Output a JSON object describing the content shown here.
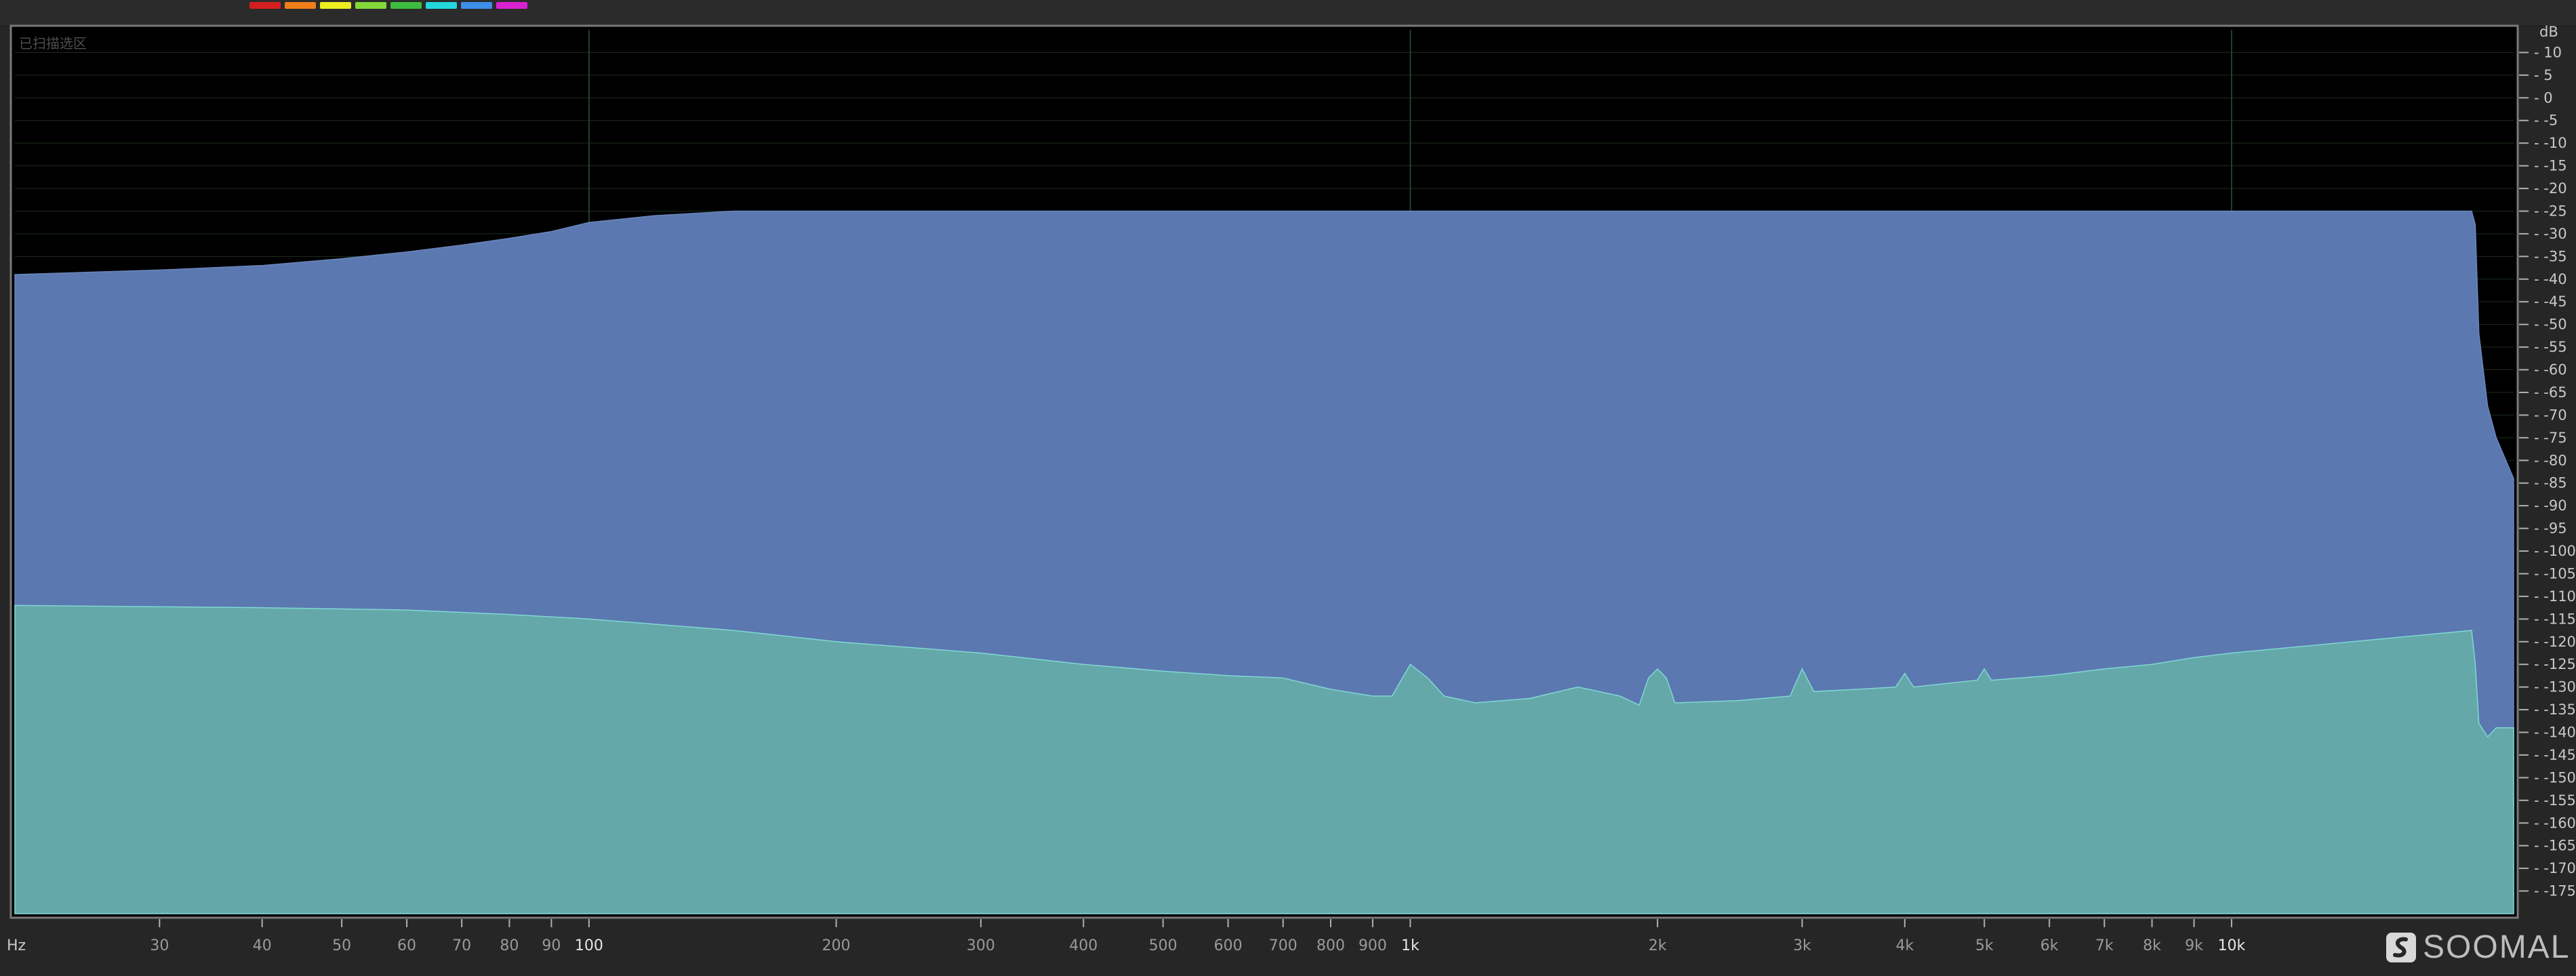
{
  "toolbar": {
    "color_swatches": [
      "#d41f1f",
      "#f07f1a",
      "#eded21",
      "#82d838",
      "#3dbc3d",
      "#24d6dc",
      "#3d8fe8",
      "#d821d0"
    ]
  },
  "overlay_label": "已扫描选区",
  "brand": {
    "name": "SOOMAL"
  },
  "chart_data": {
    "type": "area",
    "x_scale": "log",
    "xlim": [
      20,
      22050
    ],
    "ylim": [
      -180,
      15
    ],
    "xlabel": "Hz",
    "ylabel": "dB",
    "x_ticks": [
      {
        "v": 30,
        "label": "30"
      },
      {
        "v": 40,
        "label": "40"
      },
      {
        "v": 50,
        "label": "50"
      },
      {
        "v": 60,
        "label": "60"
      },
      {
        "v": 70,
        "label": "70"
      },
      {
        "v": 80,
        "label": "80"
      },
      {
        "v": 90,
        "label": "90"
      },
      {
        "v": 100,
        "label": "100"
      },
      {
        "v": 200,
        "label": "200"
      },
      {
        "v": 300,
        "label": "300"
      },
      {
        "v": 400,
        "label": "400"
      },
      {
        "v": 500,
        "label": "500"
      },
      {
        "v": 600,
        "label": "600"
      },
      {
        "v": 700,
        "label": "700"
      },
      {
        "v": 800,
        "label": "800"
      },
      {
        "v": 900,
        "label": "900"
      },
      {
        "v": 1000,
        "label": "1k"
      },
      {
        "v": 2000,
        "label": "2k"
      },
      {
        "v": 3000,
        "label": "3k"
      },
      {
        "v": 4000,
        "label": "4k"
      },
      {
        "v": 5000,
        "label": "5k"
      },
      {
        "v": 6000,
        "label": "6k"
      },
      {
        "v": 7000,
        "label": "7k"
      },
      {
        "v": 8000,
        "label": "8k"
      },
      {
        "v": 9000,
        "label": "9k"
      },
      {
        "v": 10000,
        "label": "10k"
      }
    ],
    "y_ticks": [
      10,
      5,
      0,
      -5,
      -10,
      -15,
      -20,
      -25,
      -30,
      -35,
      -40,
      -45,
      -50,
      -55,
      -60,
      -65,
      -70,
      -75,
      -80,
      -85,
      -90,
      -95,
      -100,
      -105,
      -110,
      -115,
      -120,
      -125,
      -130,
      -135,
      -140,
      -145,
      -150,
      -155,
      -160,
      -165,
      -170,
      -175
    ],
    "major_gridlines_x": [
      100,
      1000,
      10000
    ],
    "grid": true,
    "series": [
      {
        "color": "#5c78b0",
        "x": [
          20,
          30,
          40,
          50,
          60,
          70,
          80,
          90,
          100,
          120,
          150,
          200,
          500,
          1000,
          5000,
          10000,
          15000,
          19600,
          19800,
          20000,
          20500,
          21000,
          22050
        ],
        "y": [
          -39,
          -38,
          -37,
          -35.5,
          -34,
          -32.5,
          -31,
          -29.5,
          -27.5,
          -26,
          -25,
          -25,
          -25,
          -25,
          -25,
          -25,
          -25,
          -25,
          -28,
          -52,
          -68,
          -75,
          -84
        ]
      },
      {
        "color": "#65a8aa",
        "x": [
          20,
          40,
          60,
          80,
          100,
          150,
          200,
          300,
          400,
          500,
          600,
          700,
          800,
          900,
          950,
          1000,
          1050,
          1100,
          1200,
          1400,
          1600,
          1800,
          1900,
          1950,
          2000,
          2050,
          2100,
          2500,
          2900,
          3000,
          3100,
          3500,
          3900,
          4000,
          4100,
          4900,
          5000,
          5100,
          6000,
          7000,
          8000,
          9000,
          10000,
          15000,
          19600,
          19800,
          20000,
          20500,
          21000,
          22050
        ],
        "y": [
          -112,
          -112.5,
          -113,
          -114,
          -115,
          -117.5,
          -120,
          -122.5,
          -125,
          -126.5,
          -127.5,
          -128,
          -130.5,
          -132,
          -132,
          -125,
          -128,
          -132,
          -133.5,
          -132.5,
          -130,
          -132,
          -134,
          -128,
          -126,
          -128,
          -133.5,
          -133,
          -132,
          -126,
          -131,
          -130.5,
          -130,
          -127,
          -130,
          -128.5,
          -126,
          -128.5,
          -127.5,
          -126,
          -125,
          -123.5,
          -122.5,
          -119.5,
          -117.5,
          -125,
          -138,
          -141,
          -139,
          -139
        ]
      }
    ],
    "annotations": [
      {
        "type": "peak",
        "x": 1000,
        "y": -125
      },
      {
        "type": "peak",
        "x": 2000,
        "y": -126
      },
      {
        "type": "peak",
        "x": 3000,
        "y": -126
      },
      {
        "type": "peak",
        "x": 4000,
        "y": -127
      },
      {
        "type": "peak",
        "x": 5000,
        "y": -126
      },
      {
        "type": "peak",
        "x": 8000,
        "y": -122
      }
    ]
  }
}
